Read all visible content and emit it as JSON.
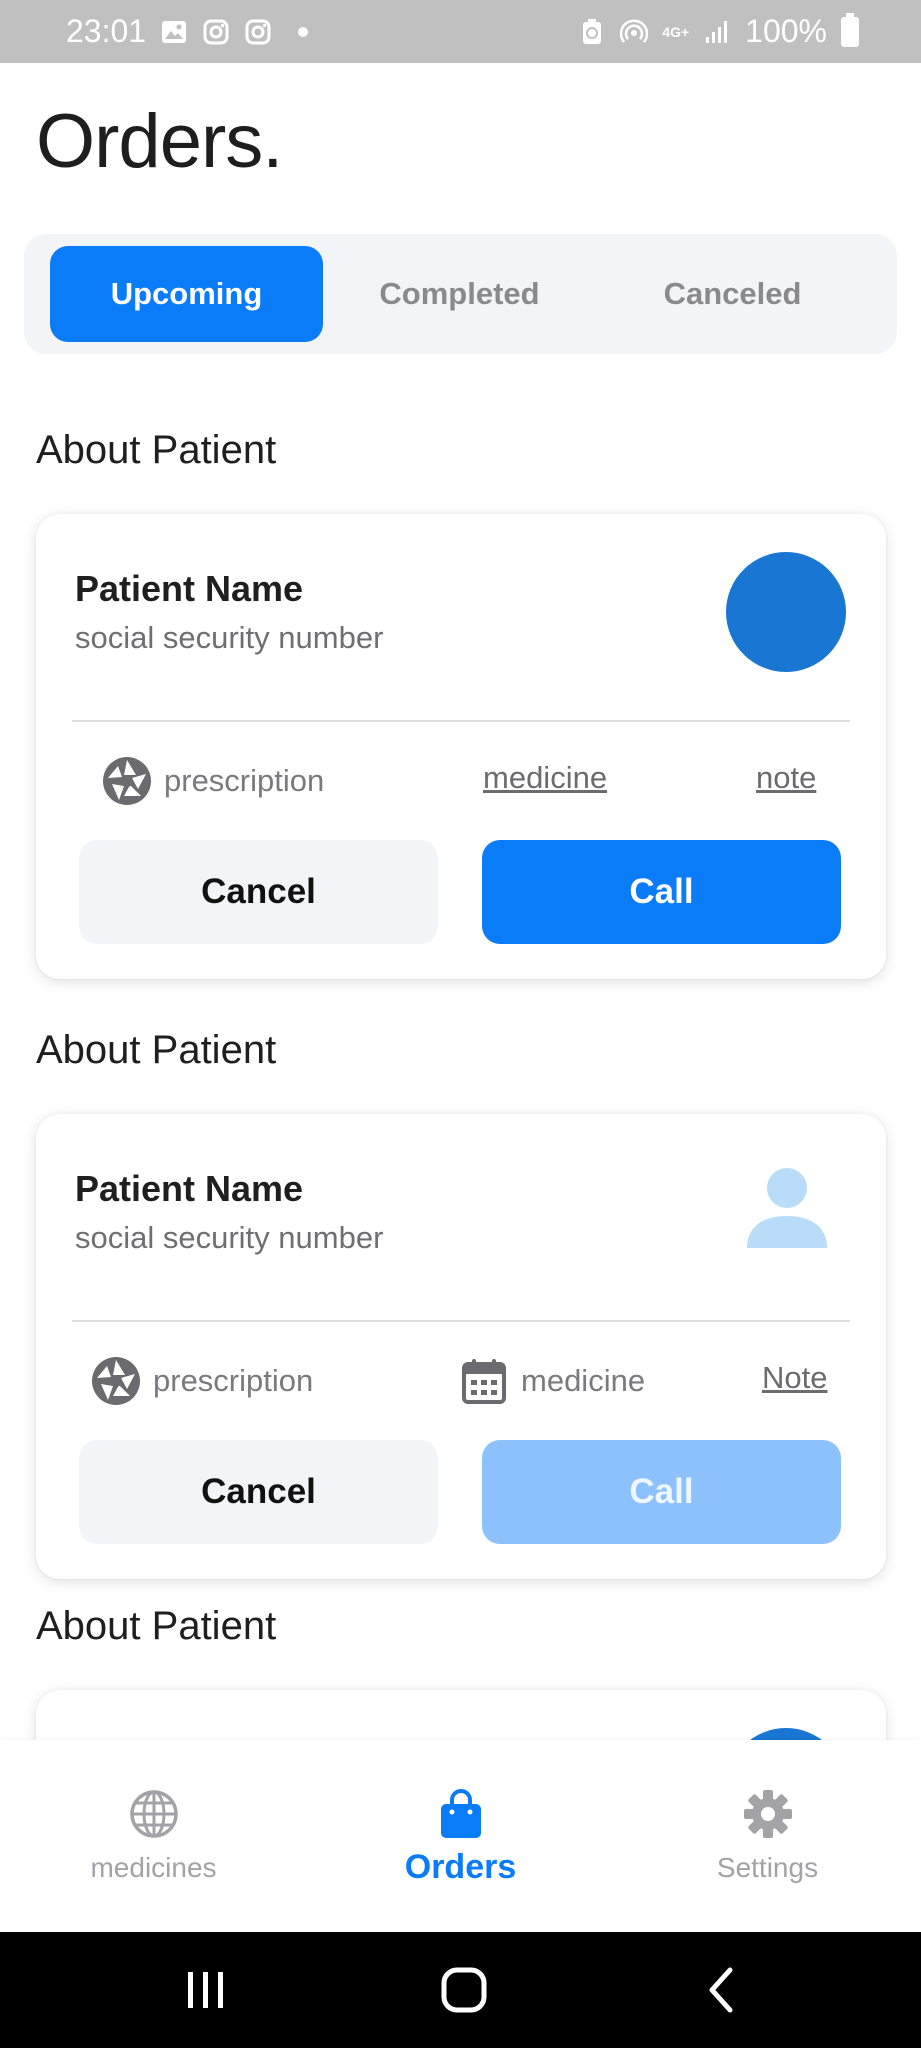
{
  "status_bar": {
    "time": "23:01",
    "battery_text": "100%",
    "network_text": "4G+",
    "left_icons": [
      "image-icon",
      "instagram-icon",
      "instagram-icon",
      "dot-icon"
    ],
    "right_icons": [
      "battery-saver-icon",
      "hotspot-icon",
      "network-4g-icon",
      "signal-icon",
      "battery-icon"
    ]
  },
  "page": {
    "title": "Orders."
  },
  "tabs": [
    {
      "label": "Upcoming",
      "active": true
    },
    {
      "label": "Completed",
      "active": false
    },
    {
      "label": "Canceled",
      "active": false
    }
  ],
  "orders": [
    {
      "section_title": "About Patient",
      "patient_name": "Patient Name",
      "patient_subtitle": "social security number",
      "avatar": "filled-circle",
      "info": [
        {
          "icon": "aperture-icon",
          "text": "prescription"
        },
        {
          "text": "medicine",
          "link": true
        },
        {
          "text": "note",
          "link": true
        }
      ],
      "cancel_label": "Cancel",
      "call_label": "Call",
      "call_enabled": true
    },
    {
      "section_title": "About Patient",
      "patient_name": "Patient Name",
      "patient_subtitle": "social security number",
      "avatar": "person-icon",
      "info": [
        {
          "icon": "aperture-icon",
          "text": "prescription"
        },
        {
          "icon": "calendar-icon",
          "text": "medicine"
        },
        {
          "text": "Note",
          "link": true
        }
      ],
      "cancel_label": "Cancel",
      "call_label": "Call",
      "call_enabled": false
    },
    {
      "section_title": "About Patient"
    }
  ],
  "bottom_nav": [
    {
      "label": "medicines",
      "icon": "globe-icon",
      "active": false
    },
    {
      "label": "Orders",
      "icon": "shopping-bag-icon",
      "active": true
    },
    {
      "label": "Settings",
      "icon": "gear-icon",
      "active": false
    }
  ],
  "colors": {
    "accent": "#0a7cf8",
    "accent_disabled": "#8cc1fb",
    "avatar": "#1976d2",
    "avatar_light": "#b9dcf8",
    "tab_background": "#f3f4f8",
    "status_bar": "#c0c0c0"
  }
}
